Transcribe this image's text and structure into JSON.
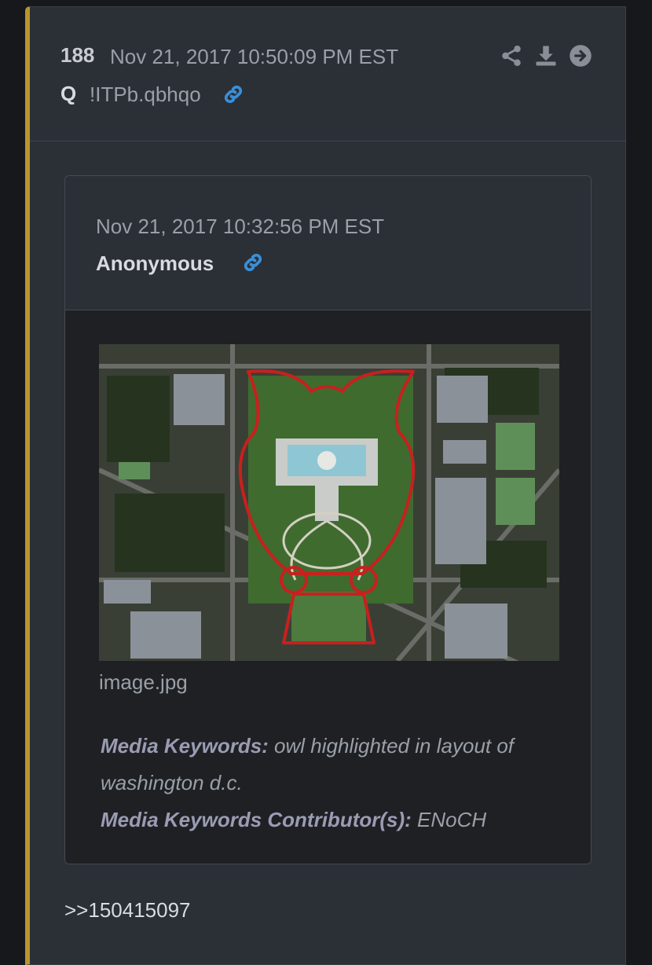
{
  "post": {
    "number": "188",
    "date": "Nov 21, 2017 10:50:09 PM EST",
    "author": "Q",
    "tripcode": "!ITPb.qbhqo",
    "actions": [
      "share-icon",
      "download-icon",
      "arrow-right-circle-icon"
    ],
    "reply_ref": ">>150415097"
  },
  "quoted": {
    "date": "Nov 21, 2017 10:32:56 PM EST",
    "author": "Anonymous",
    "media": {
      "filename": "image.jpg",
      "keywords_label": "Media Keywords:",
      "keywords_value": " owl highlighted in layout of washington d.c.",
      "contributors_label": "Media Keywords Contributor(s):",
      "contributors_value": " ENoCH"
    }
  },
  "colors": {
    "accent_bar": "#b8962e",
    "link_icon": "#3a8fd6",
    "outline_red": "#c8201e"
  }
}
